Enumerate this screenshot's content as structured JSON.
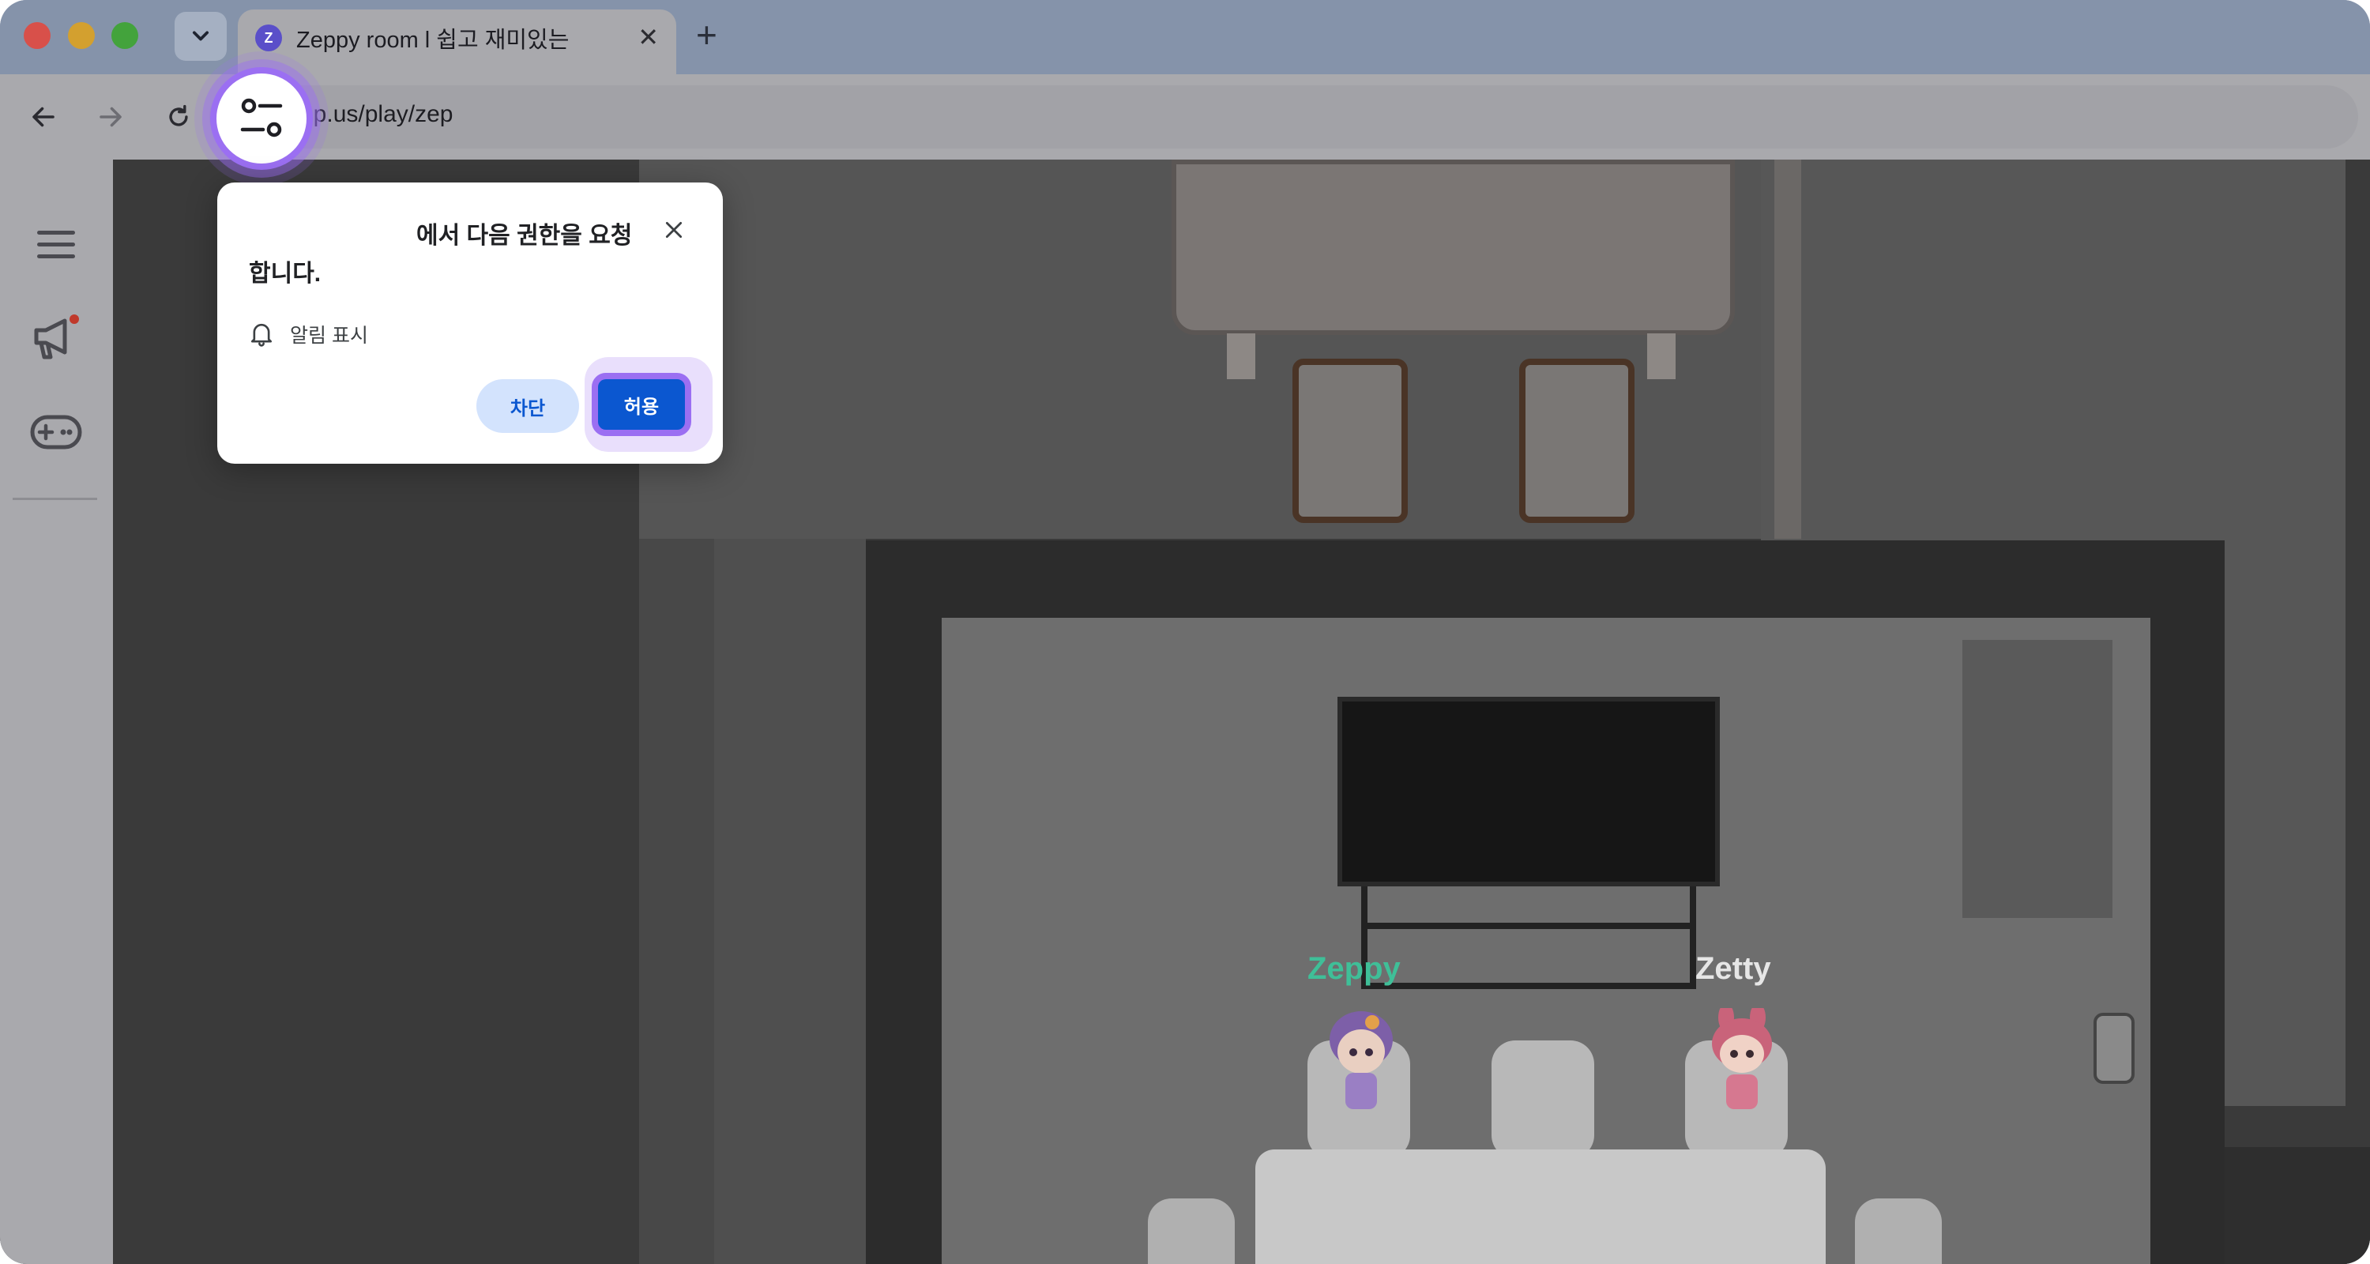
{
  "browser": {
    "tab": {
      "title": "Zeppy room l 쉽고 재미있는",
      "favicon": "zep-logo-icon",
      "close_glyph": "✕"
    },
    "new_tab_glyph": "+",
    "address_bar": {
      "url": "ep.us/play/zep"
    },
    "icons": [
      "chevron-down-icon",
      "back-arrow-icon",
      "forward-arrow-icon",
      "reload-icon",
      "site-settings-icon"
    ]
  },
  "sidebar": {
    "items": [
      {
        "icon": "menu-icon"
      },
      {
        "icon": "megaphone-icon",
        "has_notification": true
      },
      {
        "icon": "gamepad-icon"
      }
    ]
  },
  "game": {
    "avatars": [
      {
        "name": "Zeppy",
        "color": "#3fbf98"
      },
      {
        "name": "Zetty",
        "color": "#e6e6e6"
      }
    ]
  },
  "permission_dialog": {
    "title_line1": "에서 다음 권한을 요청",
    "title_line2": "합니다.",
    "permission_label": "알림 표시",
    "permission_icon": "bell-icon",
    "block_label": "차단",
    "allow_label": "허용"
  },
  "colors": {
    "highlight": "#9b6ff2",
    "allow_button": "#0b57d0",
    "block_button_bg": "#d3e3fd"
  }
}
